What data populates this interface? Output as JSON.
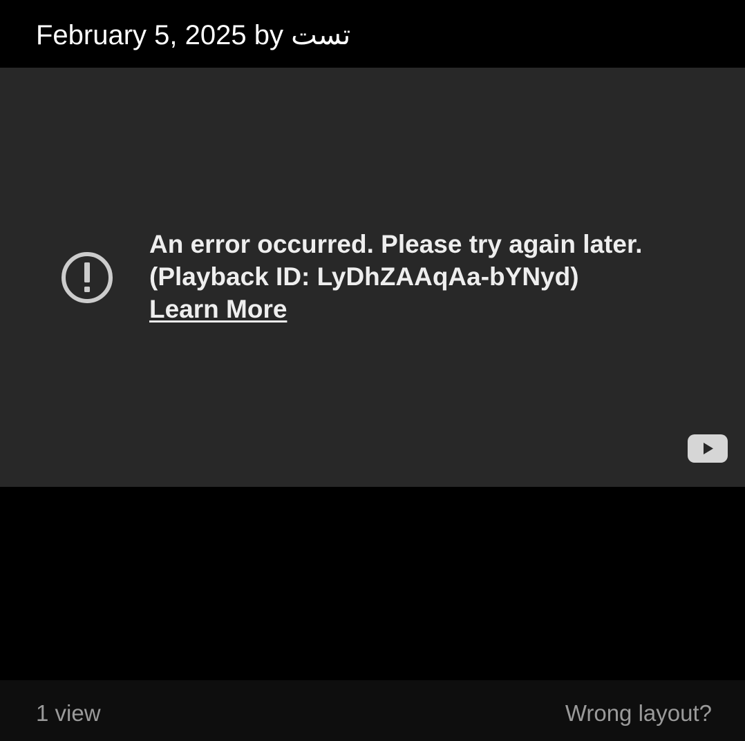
{
  "post": {
    "date": "February 5, 2025",
    "by_label": "by",
    "author": "تست"
  },
  "player": {
    "error_message": "An error occurred. Please try again later.",
    "playback_id": "(Playback ID: LyDhZAAqAa-bYNyd)",
    "learn_more": "Learn More",
    "icons": {
      "error": "exclamation-circle-icon",
      "logo": "youtube-logo-icon"
    },
    "colors": {
      "background": "#282828",
      "text": "#eeeeee",
      "icon": "#cccccc"
    }
  },
  "footer": {
    "views": "1 view",
    "wrong_layout": "Wrong layout?"
  }
}
